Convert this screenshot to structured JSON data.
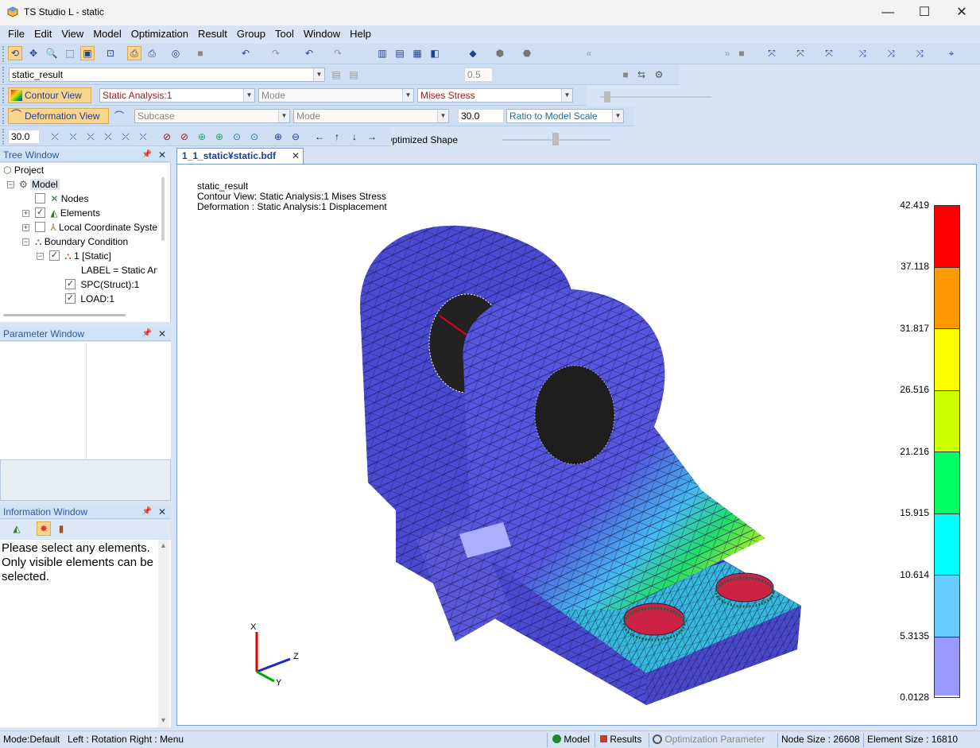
{
  "window": {
    "title": "TS Studio L - static",
    "min_glyph": "—",
    "max_glyph": "☐",
    "close_glyph": "✕"
  },
  "menubar": [
    "File",
    "Edit",
    "View",
    "Model",
    "Optimization",
    "Result",
    "Group",
    "Tool",
    "Window",
    "Help"
  ],
  "toolbar_result": {
    "result_select": "static_result",
    "optimized_shape_label": "Optimized Shape",
    "optimized_shape_value": "0.5"
  },
  "toolbar_contour": {
    "contour_view_label": "Contour View",
    "analysis_select": "Static Analysis:1",
    "mode_select": "Mode",
    "stress_select": "Mises Stress"
  },
  "toolbar_deformation": {
    "deformation_view_label": "Deformation View",
    "subcase_select": "Subcase",
    "mode_select": "Mode",
    "scale_value": "30.0",
    "scale_type_select": "Ratio to Model Scale"
  },
  "toolbar_view": {
    "angle_value": "30.0"
  },
  "tree_window": {
    "title": "Tree Window",
    "items": [
      {
        "label": "Project"
      },
      {
        "label": "Model"
      },
      {
        "label": "Nodes"
      },
      {
        "label": "Elements"
      },
      {
        "label": "Local Coordinate Syste"
      },
      {
        "label": "Boundary Condition"
      },
      {
        "label": "1 [Static]"
      },
      {
        "label": "LABEL = Static An"
      },
      {
        "label": "SPC(Struct):1"
      },
      {
        "label": "LOAD:1"
      }
    ]
  },
  "parameter_window": {
    "title": "Parameter Window"
  },
  "information_window": {
    "title": "Information Window",
    "message_lines": [
      "Please select any elements.",
      "Only visible elements can be",
      "selected."
    ]
  },
  "document_tab": {
    "label": "1_1_static¥static.bdf"
  },
  "viewport": {
    "info_lines": [
      "static_result",
      "Contour View: Static Analysis:1 Mises Stress",
      "Deformation : Static Analysis:1 Displacement"
    ],
    "axes": {
      "x": "X",
      "y": "Y",
      "z": "Z"
    },
    "color_scale": {
      "labels": [
        "42.419",
        "37.118",
        "31.817",
        "26.516",
        "21.216",
        "15.915",
        "10.614",
        "5.3135",
        "0.0128"
      ],
      "colors": [
        "#ff0000",
        "#ff9900",
        "#ffff00",
        "#ccff00",
        "#00ff66",
        "#00ffff",
        "#66ccff",
        "#9999ff"
      ]
    }
  },
  "statusbar": {
    "mode": "Mode:Default",
    "hint": "Left : Rotation Right : Menu",
    "model_label": "Model",
    "results_label": "Results",
    "opt_param_label": "Optimization Parameter",
    "node_size": "Node Size : 26608",
    "element_size": "Element Size : 16810"
  }
}
